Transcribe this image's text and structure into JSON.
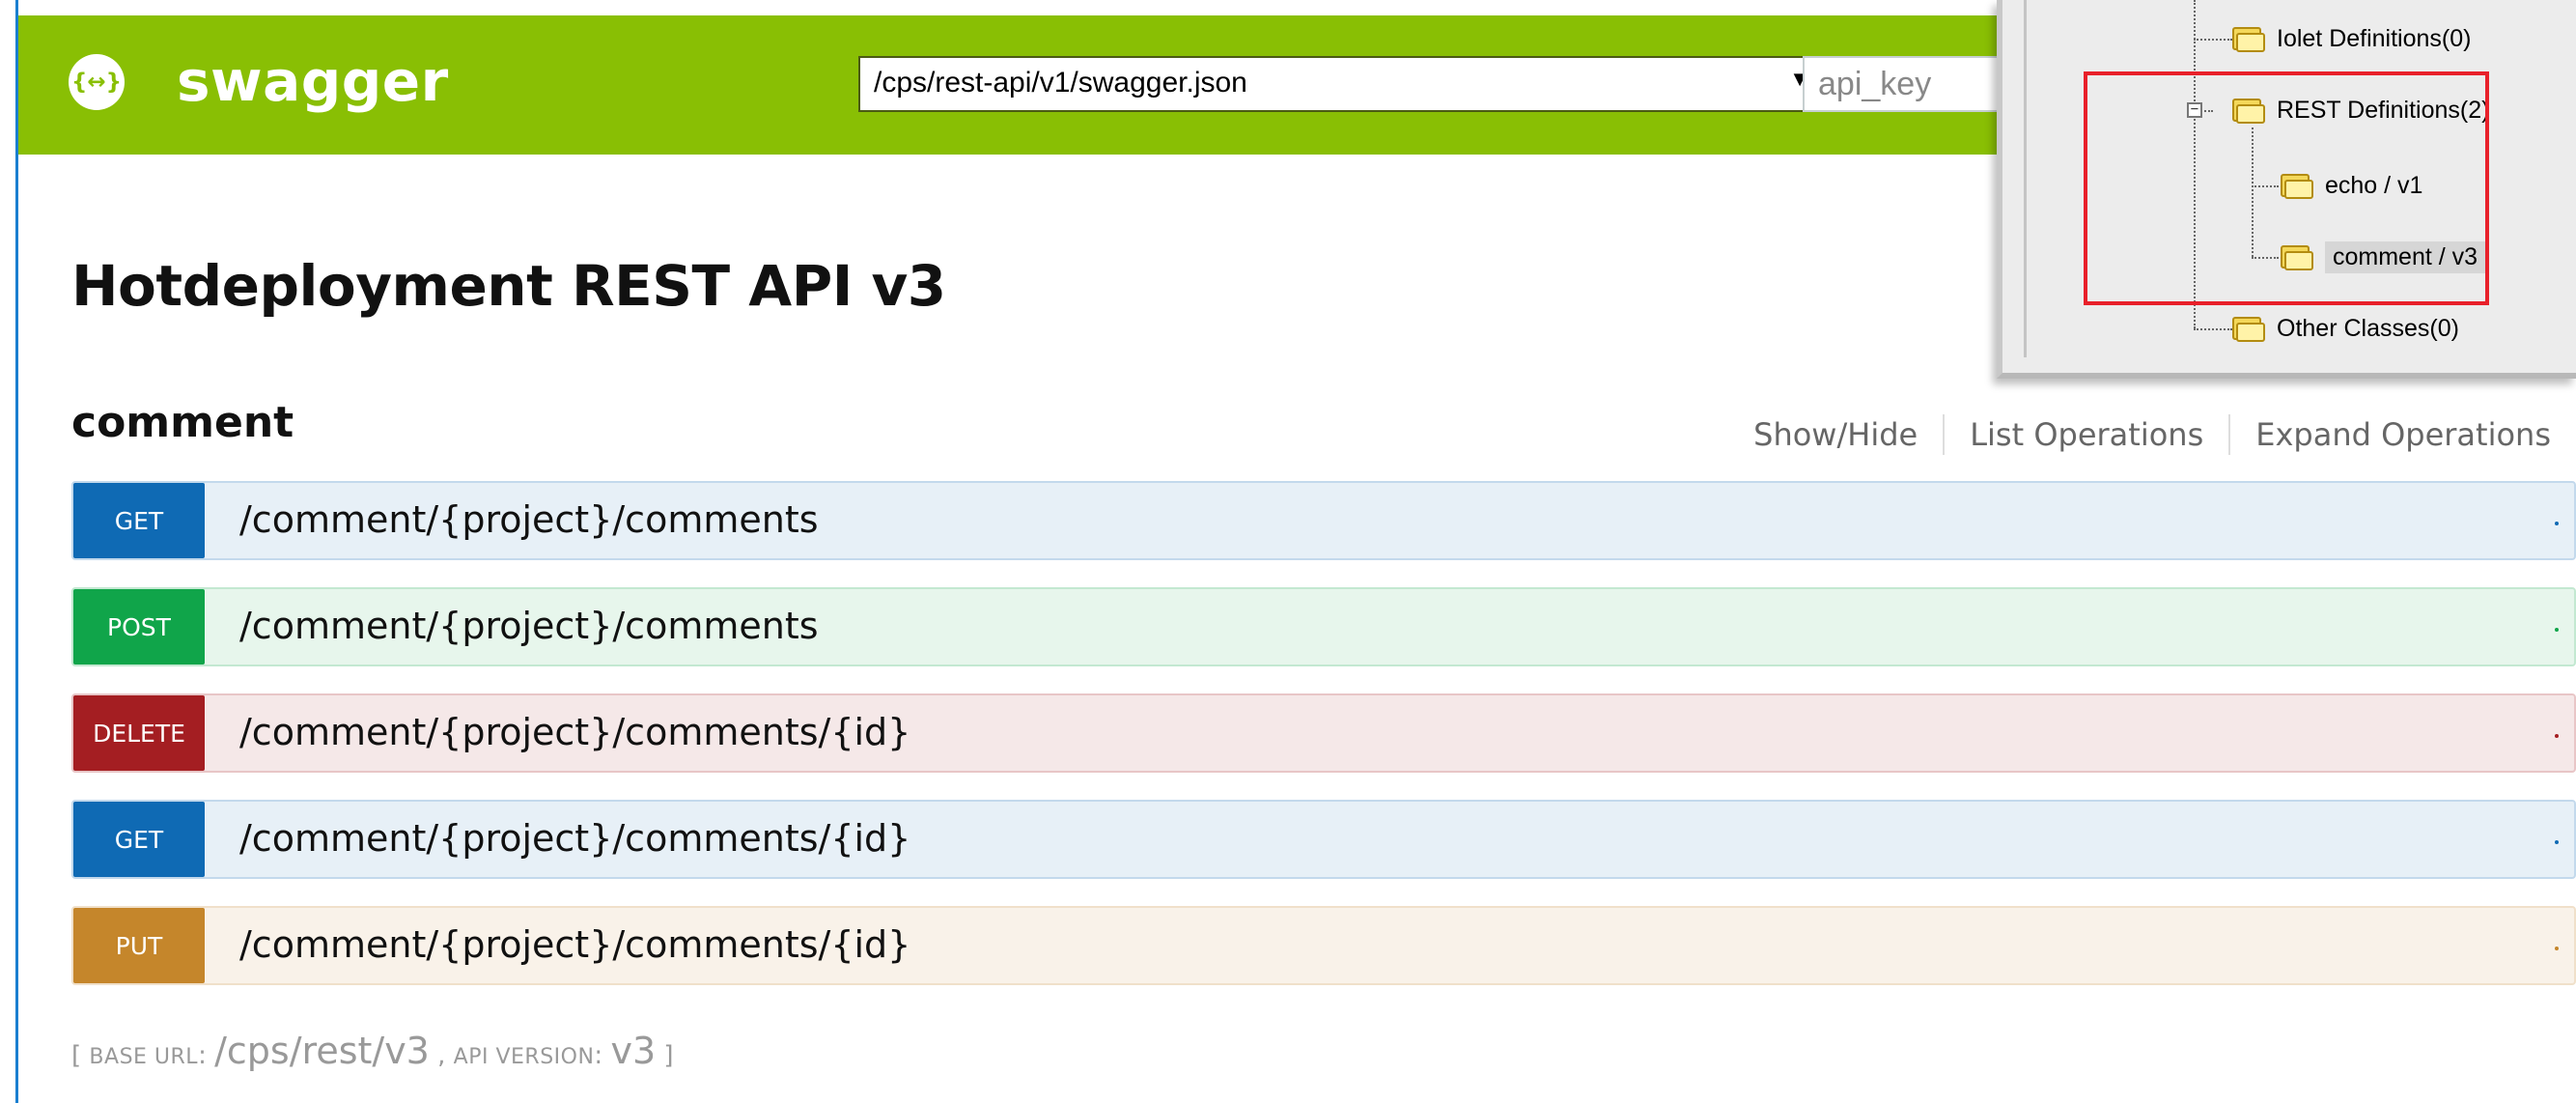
{
  "header": {
    "logo_icon": "{↔}",
    "logo_text": "swagger",
    "spec_url": "/cps/rest-api/v1/swagger.json",
    "spec_arrow": "▼",
    "api_key_placeholder": "api_key",
    "brand_color": "#89bf04"
  },
  "main": {
    "title": "Hotdeployment REST API v3",
    "resource": {
      "name": "comment",
      "links": [
        "Show/Hide",
        "List Operations",
        "Expand Operations"
      ]
    },
    "operations": [
      {
        "method": "GET",
        "path": "/comment/{project}/comments",
        "color": "#0f6ab4"
      },
      {
        "method": "POST",
        "path": "/comment/{project}/comments",
        "color": "#10a54a"
      },
      {
        "method": "DELETE",
        "path": "/comment/{project}/comments/{id}",
        "color": "#a41e22"
      },
      {
        "method": "GET",
        "path": "/comment/{project}/comments/{id}",
        "color": "#0f6ab4"
      },
      {
        "method": "PUT",
        "path": "/comment/{project}/comments/{id}",
        "color": "#c5862b"
      }
    ],
    "base_url": {
      "open": "[ ",
      "base_label": "Base url",
      "base_value": "/cps/rest/v3",
      "sep": " , ",
      "version_label": "Api version",
      "version_value": "v3",
      "close": " ]",
      "colon": ": "
    }
  },
  "tree": {
    "items": [
      {
        "label": "Iolet Definitions(0)"
      },
      {
        "label": "REST Definitions(2)",
        "expander": "−"
      },
      {
        "label": "echo / v1"
      },
      {
        "label": "comment / v3",
        "selected": true
      },
      {
        "label": "Other Classes(0)"
      }
    ],
    "highlight_color": "#e8202a"
  }
}
